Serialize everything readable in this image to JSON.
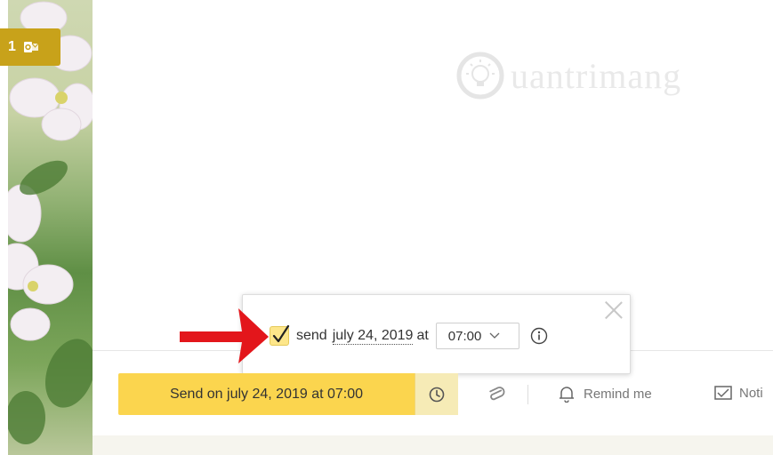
{
  "sidebar": {
    "badge_count": "1",
    "badge_icon": "outlook-icon"
  },
  "watermark": {
    "text": "uantrimang",
    "icon": "lightbulb-logo-icon"
  },
  "schedule_popup": {
    "checkbox_checked": true,
    "send_label": "send",
    "date": "july 24, 2019",
    "at_label": "at",
    "time_value": "07:00",
    "info_icon": "info-icon",
    "close_icon": "close-icon"
  },
  "toolbar": {
    "send_button_label": "Send on july 24, 2019 at 07:00",
    "clock_icon": "clock-icon",
    "attach_icon": "paperclip-icon",
    "remind_label": "Remind me",
    "remind_icon": "bell-icon",
    "notify_label": "Noti",
    "notify_icon": "envelope-check-icon"
  },
  "colors": {
    "accent_yellow": "#fbd54e",
    "clock_button_bg": "#f6ebb6",
    "checkbox_bg": "#fde68a",
    "badge_gold": "#c8a21a",
    "arrow_red": "#e3161b"
  }
}
